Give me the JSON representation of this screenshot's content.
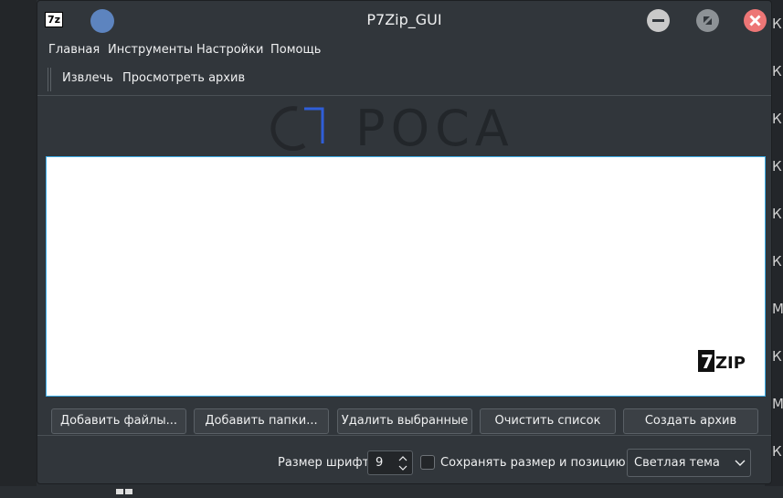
{
  "window": {
    "title": "P7Zip_GUI",
    "app_icon_text": "7z",
    "accent_color": "#3daee9"
  },
  "menu": {
    "items": [
      "Главная",
      "Инструменты",
      "Настройки",
      "Помощь"
    ]
  },
  "toolbar": {
    "extract_label": "Извлечь",
    "view_label": "Просмотреть архив"
  },
  "branding": {
    "logo_text": "POCA",
    "zip_logo_text": "ZIP",
    "zip_logo_number": "7"
  },
  "actions": {
    "add_files": "Добавить файлы...",
    "add_folders": "Добавить папки...",
    "remove_selected": "Удалить выбранные",
    "clear_list": "Очистить список",
    "create_archive": "Создать архив"
  },
  "status": {
    "font_size_label": "Размер шрифта:",
    "font_size_value": "9",
    "save_position_label": "Сохранять размер и позицию окна",
    "theme_value": "Светлая тема"
  },
  "background": {
    "letters": [
      "К",
      "К",
      "К",
      "К",
      "К",
      "К",
      "М",
      "К",
      "М",
      "К"
    ]
  }
}
